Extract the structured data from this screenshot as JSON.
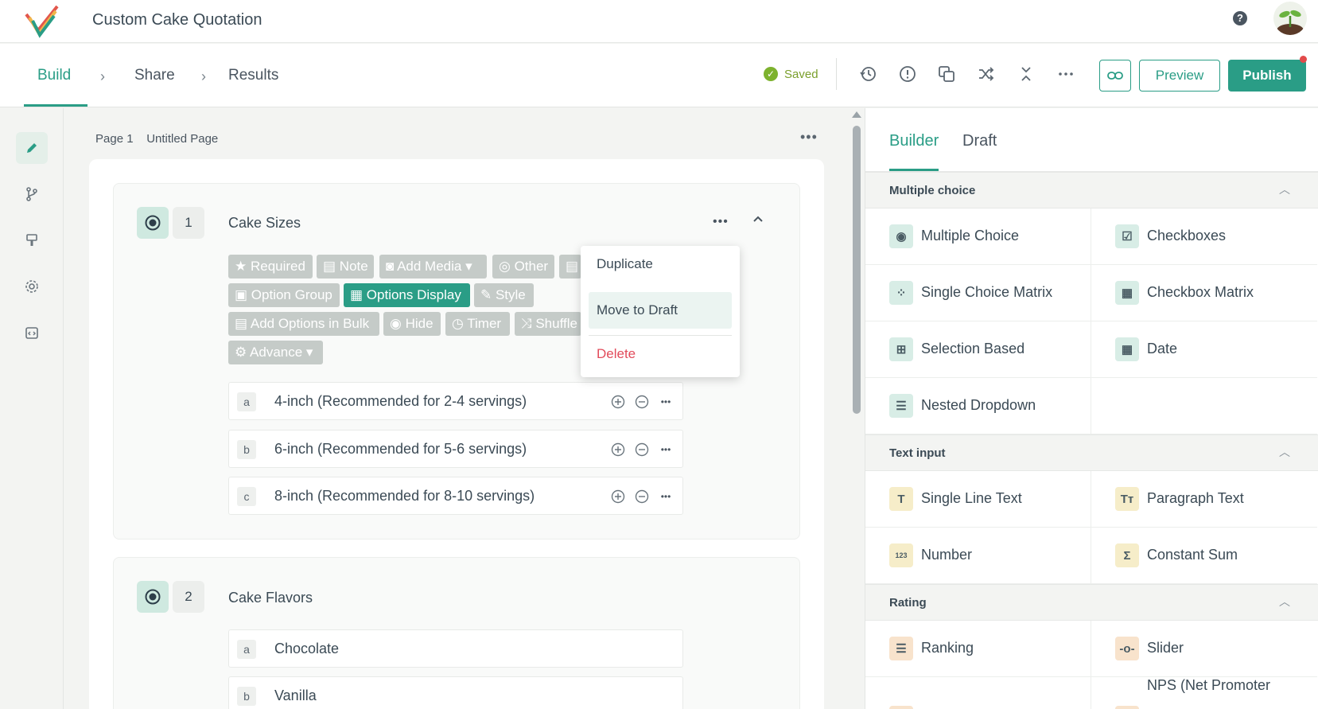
{
  "app": {
    "title": "Custom Cake Quotation"
  },
  "nav": {
    "tabs": [
      "Build",
      "Share",
      "Results"
    ],
    "saved": "Saved",
    "preview": "Preview",
    "publish": "Publish"
  },
  "toolbar_icons": [
    "history-icon",
    "alert-icon",
    "copy-icon",
    "shuffle-icon",
    "collapse-icon",
    "more-icon",
    "link-icon"
  ],
  "rail_icons": [
    "pencil-icon",
    "branch-icon",
    "paint-icon",
    "gear-icon",
    "code-icon"
  ],
  "page": {
    "label": "Page 1",
    "name": "Untitled Page"
  },
  "questions": [
    {
      "number": "1",
      "title": "Cake Sizes",
      "chips": [
        "Required",
        "Note",
        "Add Media",
        "Other",
        "",
        "Option Group",
        "Options Display",
        "Style",
        "Add Options in Bulk",
        "Hide",
        "Timer",
        "Shuffle",
        "Advance"
      ],
      "options": [
        {
          "letter": "a",
          "text": "4-inch (Recommended for 2-4 servings)"
        },
        {
          "letter": "b",
          "text": "6-inch (Recommended for 5-6 servings)"
        },
        {
          "letter": "c",
          "text": "8-inch (Recommended for 8-10 servings)"
        }
      ]
    },
    {
      "number": "2",
      "title": "Cake Flavors",
      "options": [
        {
          "letter": "a",
          "text": "Chocolate"
        },
        {
          "letter": "b",
          "text": "Vanilla"
        }
      ]
    }
  ],
  "context_menu": {
    "items": [
      "Duplicate",
      "Move to Draft",
      "Delete"
    ],
    "highlighted": "Move to Draft"
  },
  "right_panel": {
    "tabs": [
      "Builder",
      "Draft"
    ],
    "sections": [
      {
        "title": "Multiple choice",
        "items": [
          "Multiple Choice",
          "Checkboxes",
          "Single Choice Matrix",
          "Checkbox Matrix",
          "Selection Based",
          "Date",
          "Nested Dropdown"
        ]
      },
      {
        "title": "Text input",
        "items": [
          "Single Line Text",
          "Paragraph Text",
          "Number",
          "Constant Sum"
        ]
      },
      {
        "title": "Rating",
        "items": [
          "Ranking",
          "Slider",
          "",
          "NPS (Net Promoter"
        ]
      }
    ]
  },
  "colors": {
    "accent": "#2a9d86",
    "saved": "#7db22e",
    "delete": "#e24b5b",
    "chip": "#c5cbc8"
  }
}
